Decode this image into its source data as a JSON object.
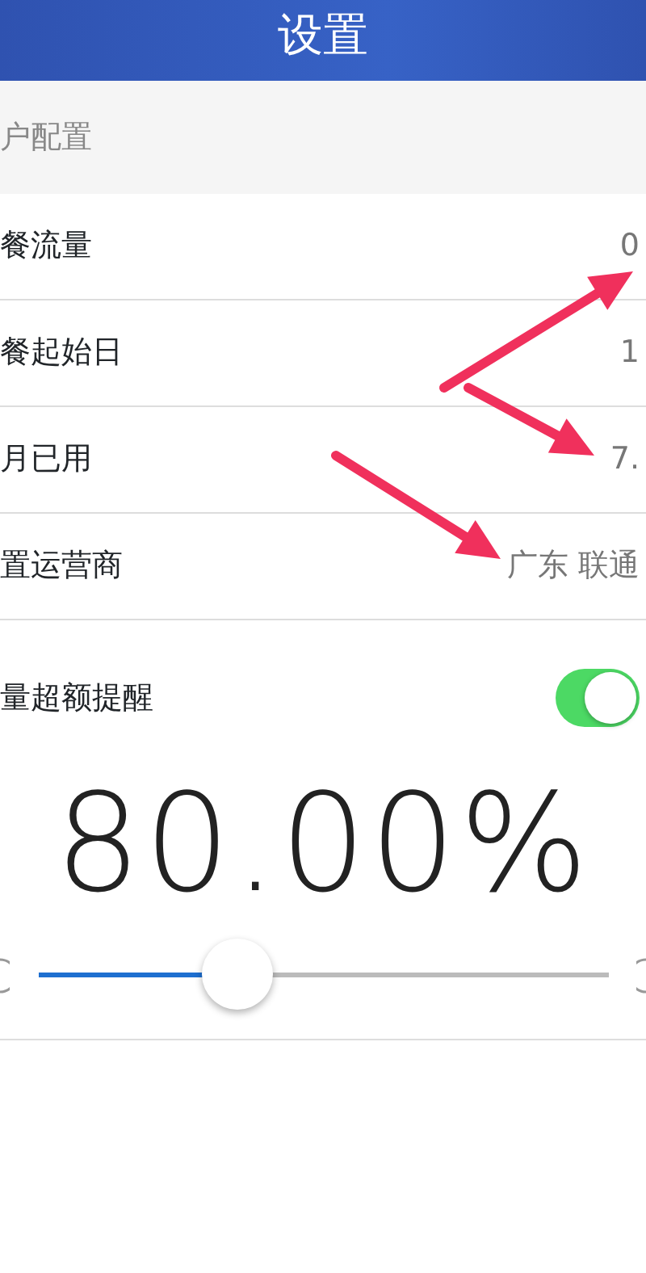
{
  "navbar": {
    "title": "设置"
  },
  "section": {
    "title": "户配置"
  },
  "rows": [
    {
      "label": "餐流量",
      "value": "0"
    },
    {
      "label": "餐起始日",
      "value": "1"
    },
    {
      "label": "月已用",
      "value": "7."
    },
    {
      "label": "置运营商",
      "value": "广东 联通"
    }
  ],
  "alert": {
    "label": "量超额提醒",
    "on": true,
    "percent": "80.00%",
    "level": 0.35
  }
}
